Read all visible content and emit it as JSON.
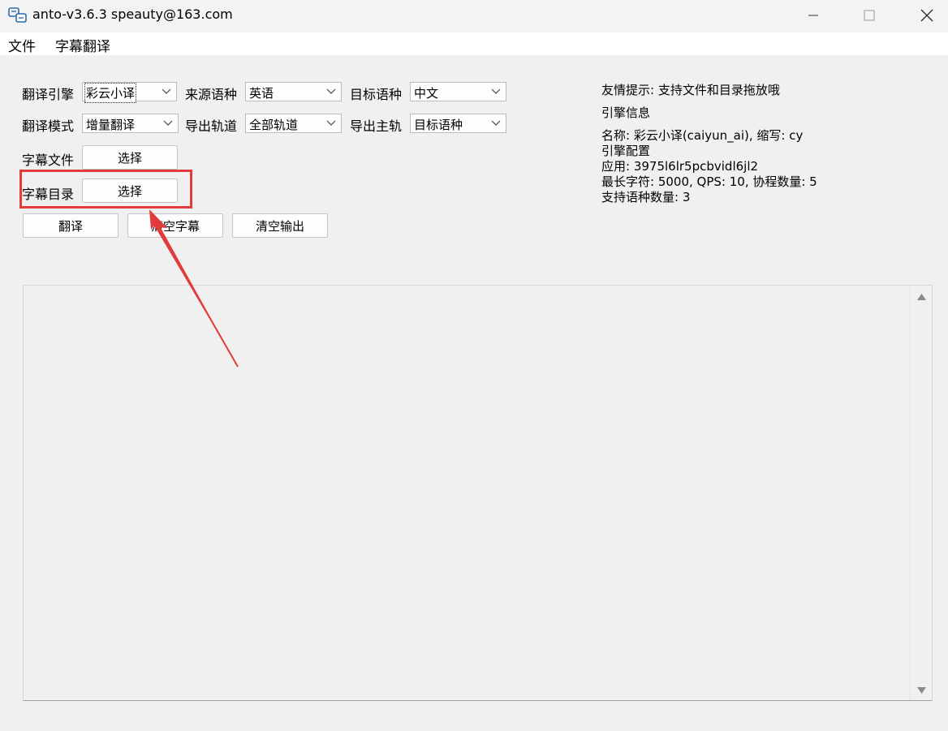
{
  "window": {
    "title": "anto-v3.6.3 speauty@163.com"
  },
  "menu": {
    "file": "文件",
    "subtitle_translate": "字幕翻译"
  },
  "form": {
    "engine_label": "翻译引擎",
    "engine_value": "彩云小译",
    "source_lang_label": "来源语种",
    "source_lang_value": "英语",
    "target_lang_label": "目标语种",
    "target_lang_value": "中文",
    "mode_label": "翻译模式",
    "mode_value": "增量翻译",
    "export_track_label": "导出轨道",
    "export_track_value": "全部轨道",
    "export_main_track_label": "导出主轨",
    "export_main_track_value": "目标语种",
    "subtitle_file_label": "字幕文件",
    "subtitle_file_button": "选择",
    "subtitle_dir_label": "字幕目录",
    "subtitle_dir_button": "选择"
  },
  "actions": {
    "translate": "翻译",
    "clear_subtitles": "清空字幕",
    "clear_output": "清空输出"
  },
  "info": {
    "tip": "友情提示: 支持文件和目录拖放哦",
    "engine_info_heading": "引擎信息",
    "name_line": "名称: 彩云小译(caiyun_ai), 缩写: cy",
    "config_heading": "引擎配置",
    "app_line": "应用: 3975l6lr5pcbvidl6jl2",
    "limits_line": "最长字符: 5000, QPS: 10, 协程数量: 5",
    "lang_count_line": "支持语种数量: 3"
  },
  "output": {
    "value": ""
  },
  "colors": {
    "annotation": "#e23b3b",
    "window_bg": "#f0f0f0"
  },
  "icons": [
    "app-icon",
    "minimize-icon",
    "maximize-icon",
    "close-icon",
    "chevron-down-icon",
    "scroll-up-icon",
    "scroll-down-icon",
    "annotation-arrow-icon"
  ]
}
